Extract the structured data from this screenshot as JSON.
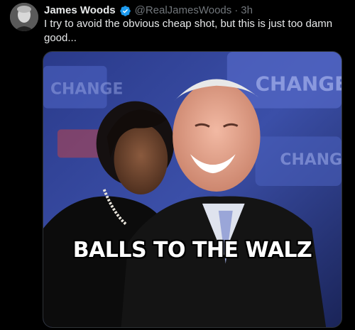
{
  "tweet": {
    "author": {
      "display_name": "James Woods",
      "handle": "@RealJamesWoods",
      "verified_icon": "verified-badge-icon",
      "avatar": "avatar"
    },
    "separator": "·",
    "time": "3h",
    "text": "I try to avoid the obvious cheap shot, but this is just too damn good...",
    "media": {
      "caption": "BALLS TO THE WALZ",
      "background_sign_text": "CHANGE",
      "colors": {
        "background": "#1a2458",
        "accent_blue": "#1d9bf0"
      }
    }
  }
}
